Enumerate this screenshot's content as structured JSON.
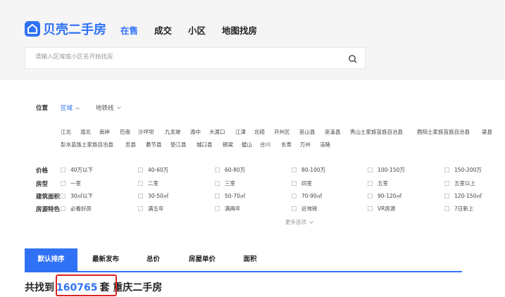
{
  "brand": {
    "name": "贝壳二手房",
    "color": "#3072f6"
  },
  "nav": {
    "items": [
      {
        "label": "在售",
        "active": true
      },
      {
        "label": "成交",
        "active": false
      },
      {
        "label": "小区",
        "active": false
      },
      {
        "label": "地图找房",
        "active": false
      }
    ]
  },
  "search": {
    "placeholder": "请输入区域或小区名开始找房",
    "icon": "search-icon"
  },
  "filters": {
    "position_label": "位置",
    "position_tabs": [
      "区域",
      "地铁线"
    ],
    "districts_row1": [
      "江北",
      "渝北",
      "南岸",
      "巴南",
      "沙坪坝",
      "九龙坡",
      "渝中",
      "大渡口",
      "江津",
      "北碚",
      "开州区",
      "巫山县",
      "巫溪县",
      "秀山土家族苗族自治县",
      "酉阳土家族苗族自治县",
      "梁县"
    ],
    "districts_row2": [
      "彭水苗族土家族自治县",
      "忠县",
      "綦节县",
      "垫江县",
      "城口县",
      "铜梁",
      "璧山",
      "合川",
      "长寿",
      "万州",
      "涪陵"
    ],
    "rows": [
      {
        "label": "价格",
        "options": [
          "40万以下",
          "40-60万",
          "60-80万",
          "80-100万",
          "100-150万",
          "150-200万"
        ]
      },
      {
        "label": "房型",
        "options": [
          "一室",
          "二室",
          "三室",
          "四室",
          "五室",
          "五室以上"
        ]
      },
      {
        "label": "建筑面积",
        "options": [
          "30㎡以下",
          "30-50㎡",
          "50-70㎡",
          "70-90㎡",
          "90-120㎡",
          "120-150㎡"
        ]
      },
      {
        "label": "房源特色",
        "options": [
          "必看好房",
          "满五年",
          "满两年",
          "近地铁",
          "VR房源",
          "7日新上"
        ]
      }
    ],
    "more_label": "更多选项"
  },
  "sort_tabs": [
    {
      "label": "默认排序",
      "active": true
    },
    {
      "label": "最新发布",
      "active": false
    },
    {
      "label": "总价",
      "active": false
    },
    {
      "label": "房屋单价",
      "active": false
    },
    {
      "label": "面积",
      "active": false
    }
  ],
  "result": {
    "prefix": "共找到",
    "count": "160765",
    "suffix": "套 重庆二手房"
  }
}
